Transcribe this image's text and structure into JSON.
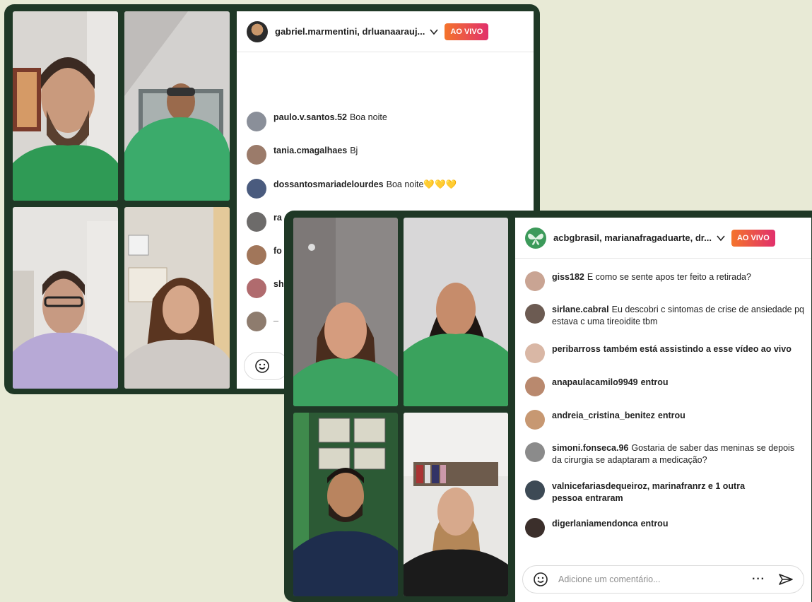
{
  "window1": {
    "title": "gabriel.marmentini, drluanaarauj...",
    "live_label": "AO VIVO",
    "messages": [
      {
        "user": "paulo.v.santos.52",
        "text": "Boa noite",
        "avatar_color": "#8a8f99"
      },
      {
        "user": "tania.cmagalhaes",
        "text": "Bj",
        "avatar_color": "#9b7b6a"
      },
      {
        "user": "dossantosmariadelourdes",
        "text": "Boa noite💛💛💛",
        "avatar_color": "#4a5b7e"
      },
      {
        "user": "ra",
        "text": "",
        "avatar_color": "#6d6b6a"
      },
      {
        "user": "fo",
        "text": "",
        "avatar_color": "#a1765a"
      },
      {
        "user": "sh",
        "text": "",
        "avatar_color": "#b06b6e"
      },
      {
        "user": "_",
        "text": "",
        "avatar_color": "#8e7c6e"
      }
    ]
  },
  "window2": {
    "title": "acbgbrasil, marianafragaduarte, dr...",
    "live_label": "AO VIVO",
    "comment_placeholder": "Adicione um comentário...",
    "more_label": "···",
    "messages": [
      {
        "user": "giss182",
        "text": "E como se sente apos ter feito a retirada?",
        "avatar_color": "#c9a493"
      },
      {
        "user": "sirlane.cabral",
        "text": "Eu descobri c sintomas de crise de ansiedade pq estava c uma tireoidite tbm",
        "avatar_color": "#6c5b52"
      },
      {
        "user": "peribarross",
        "text": "também está assistindo a esse vídeo ao vivo",
        "avatar_color": "#d9b7a5",
        "bold_text": true
      },
      {
        "user": "anapaulacamilo9949",
        "text": "entrou",
        "avatar_color": "#b9896e",
        "bold_text": true
      },
      {
        "user": "andreia_cristina_benitez",
        "text": "entrou",
        "avatar_color": "#c79872",
        "bold_text": true
      },
      {
        "user": "simoni.fonseca.96",
        "text": "Gostaria de saber das meninas se depois da cirurgia se adaptaram a medicação?",
        "avatar_color": "#8b8b8b"
      },
      {
        "user": "valnicefariasdequeiroz, marinafranrz e 1 outra pessoa",
        "text": "entraram",
        "avatar_color": "#3d4a55",
        "bold_text": true
      },
      {
        "user": "digerlaniamendonca",
        "text": "entrou",
        "avatar_color": "#3b2f2b",
        "bold_text": true
      }
    ]
  }
}
